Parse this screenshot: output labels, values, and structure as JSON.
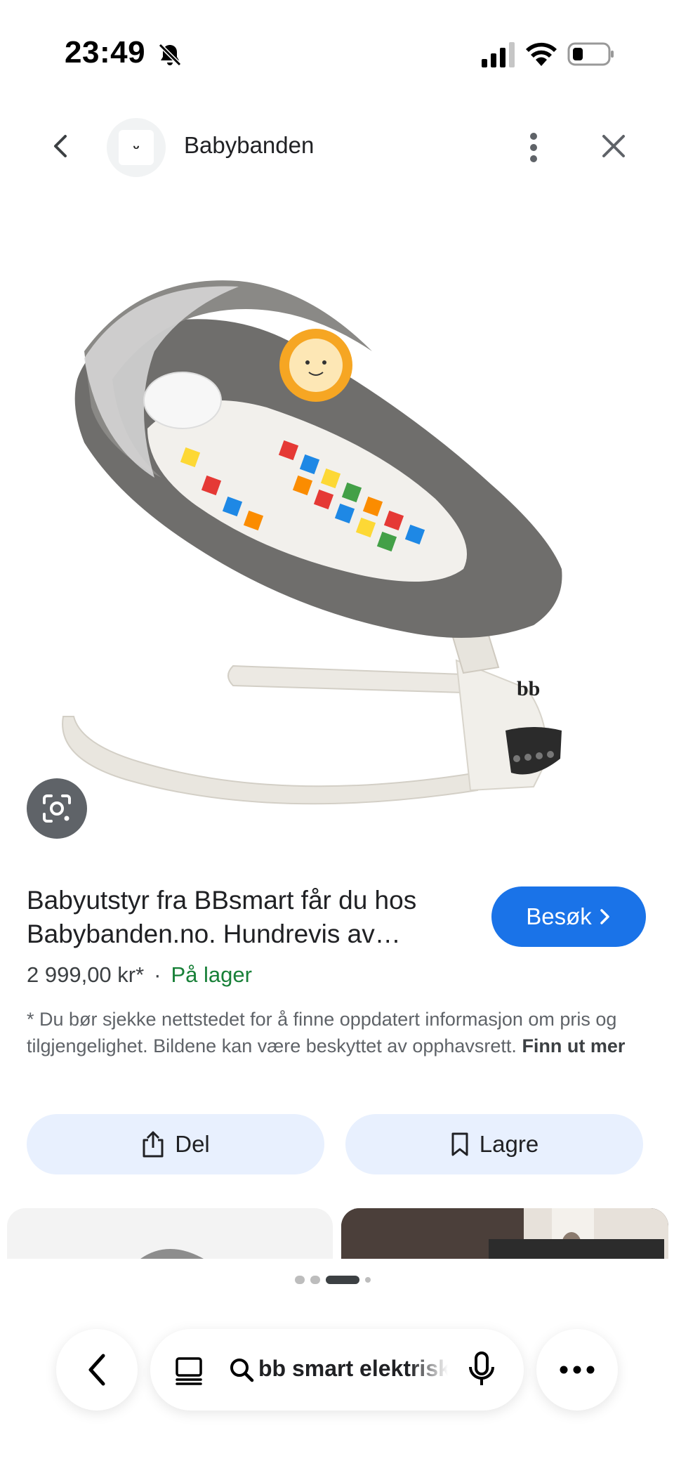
{
  "status_bar": {
    "time": "23:49"
  },
  "header": {
    "site_name": "Babybanden",
    "site_logo_glyph": "ᵕ"
  },
  "product": {
    "title": "Babyutstyr fra BBsmart får du hos Babybanden.no. Hundrevis av…",
    "price": "2 999,00 kr*",
    "separator": "·",
    "stock": "På lager",
    "visit_label": "Besøk",
    "product_image_text": "bb"
  },
  "disclaimer": {
    "text": "* Du bør sjekke nettstedet for å finne oppdatert informasjon om pris og tilgjengelighet. Bildene kan være beskyttet av opphavsrett.",
    "link": "Finn ut mer"
  },
  "actions": {
    "share_label": "Del",
    "save_label": "Lagre"
  },
  "pager": {
    "count": 4,
    "active_index": 2
  },
  "bottom_bar": {
    "query": "bb smart elektrisk"
  },
  "colors": {
    "accent": "#1a73e8",
    "action_bg": "#e8f0fe",
    "stock_green": "#188038"
  }
}
